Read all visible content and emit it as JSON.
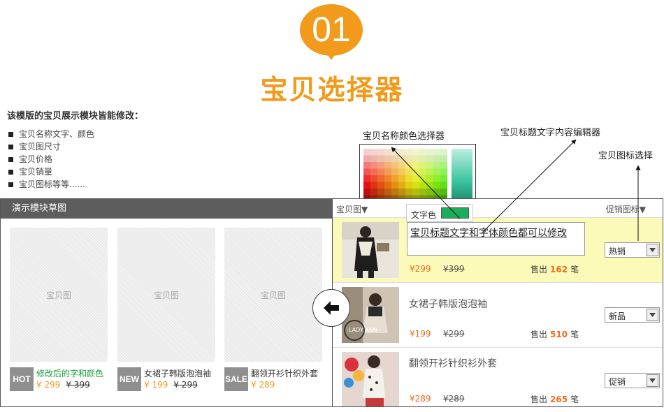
{
  "badge": {
    "number": "01"
  },
  "title": "宝贝选择器",
  "intro": {
    "heading": "该模版的宝贝展示模块皆能修改：",
    "items": [
      "宝贝名称文字、颜色",
      "宝贝图尺寸",
      "宝贝价格",
      "宝贝销量",
      "宝贝图标等等......"
    ]
  },
  "callouts": {
    "color_picker": "宝贝名称颜色选择器",
    "title_editor": "宝贝标题文字内容编辑器",
    "icon_select": "宝贝图标选择"
  },
  "tooltip": {
    "label": "文字色",
    "swatch_color": "#1aae5c"
  },
  "demo": {
    "header": "演示模块草图",
    "placeholder": "宝贝图",
    "cards": [
      {
        "tag": "HOT",
        "name": "修改后的字和颜色",
        "price": "¥ 299",
        "old_price": "¥ 399"
      },
      {
        "tag": "NEW",
        "name": "女裙子韩版泡泡袖",
        "price": "¥ 199",
        "old_price": "¥ 299"
      },
      {
        "tag": "SALE",
        "name": "翻领开衫针织外套",
        "price": "¥ 289",
        "old_price": ""
      }
    ]
  },
  "editor": {
    "col_image": "宝贝图▼",
    "col_icon": "促销图标▼",
    "sales_prefix": "售出",
    "sales_unit": "笔",
    "rows": [
      {
        "title": "宝贝标题文字和字体颜色都可以修改",
        "price": "¥299",
        "old_price": "¥399",
        "sales": "162",
        "icon": "热销"
      },
      {
        "title": "女裙子韩版泡泡袖",
        "price": "¥199",
        "old_price": "¥299",
        "sales": "510",
        "icon": "新品"
      },
      {
        "title": "翻领开衫针织衫外套",
        "price": "¥289",
        "old_price": "¥289",
        "sales": "265",
        "icon": "促销"
      }
    ]
  },
  "colors": {
    "accent": "#f19a1b",
    "price": "#f06a17",
    "highlight_row": "#fcfab8",
    "edited_name": "#1aa03c"
  }
}
